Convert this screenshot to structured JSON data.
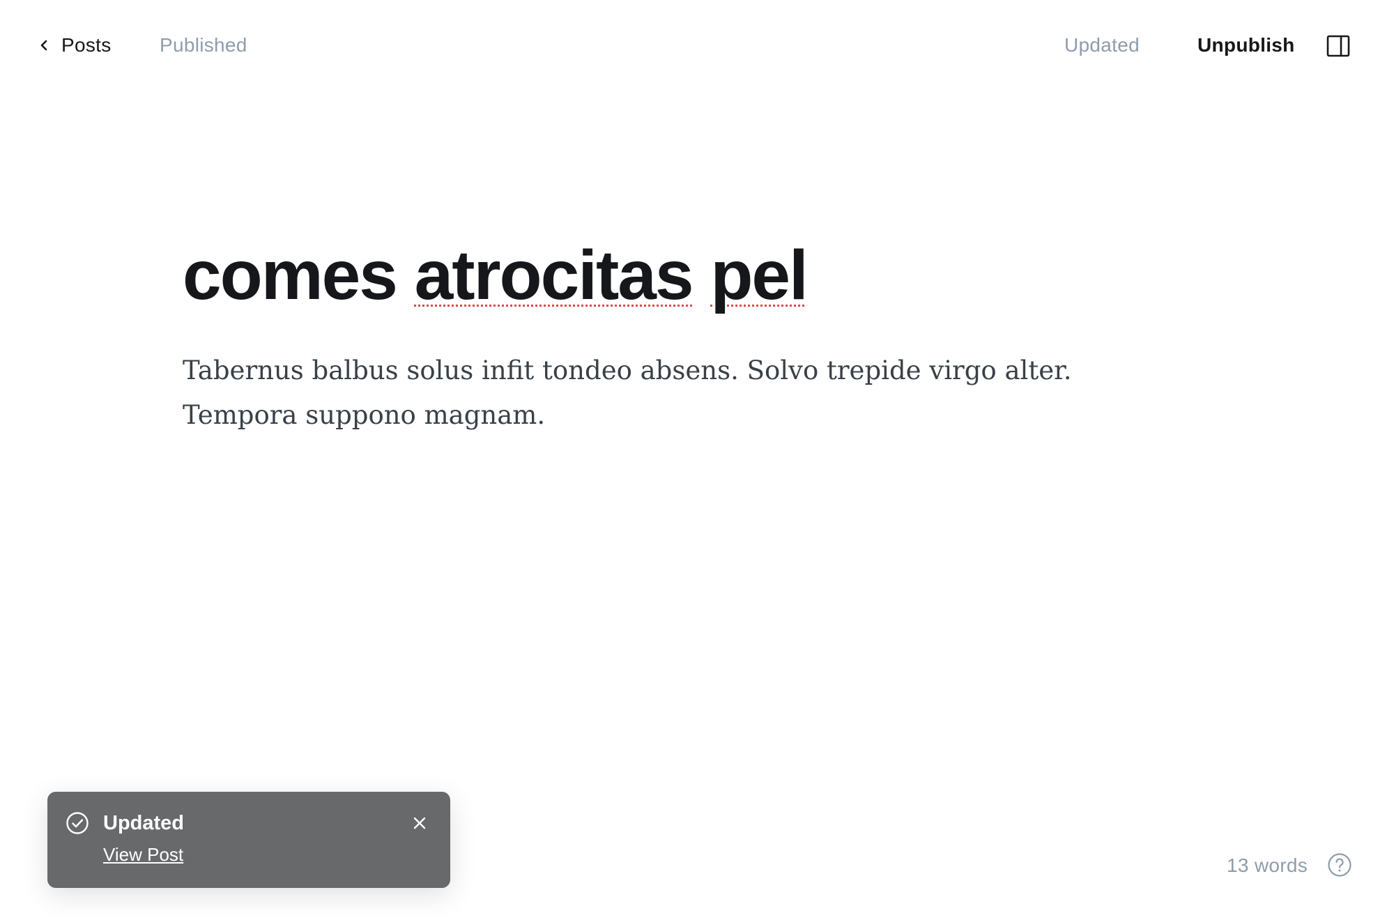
{
  "header": {
    "back_label": "Posts",
    "post_status": "Published",
    "save_status": "Updated",
    "unpublish_label": "Unpublish"
  },
  "icons": {
    "back": "chevron-left-icon",
    "sidebar": "sidebar-toggle-icon",
    "toast_status": "check-circle-icon",
    "toast_close": "close-icon",
    "help": "question-circle-icon"
  },
  "editor": {
    "title_words": [
      "comes",
      "atrocitas",
      "pel"
    ],
    "body": "Tabernus balbus solus infit tondeo absens. Solvo trepide virgo alter. Tempora suppono magnam."
  },
  "toast": {
    "title": "Updated",
    "link_label": "View Post"
  },
  "footer": {
    "word_count": "13 words"
  },
  "colors": {
    "text_primary": "#15171a",
    "text_muted": "#8e9cac",
    "body_text": "#394047",
    "toast_bg": "#68696b",
    "spellcheck": "#e0454b"
  }
}
